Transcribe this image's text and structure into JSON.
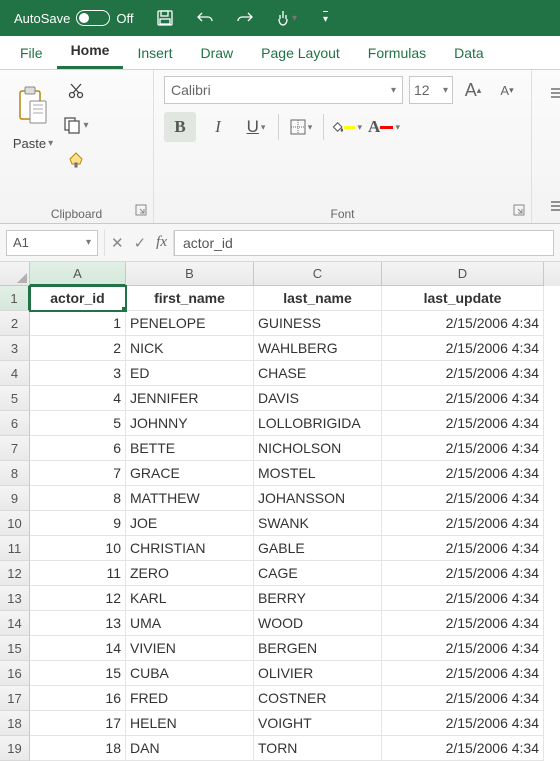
{
  "titlebar": {
    "autosave_label": "AutoSave",
    "autosave_state": "Off"
  },
  "tabs": {
    "file": "File",
    "home": "Home",
    "insert": "Insert",
    "draw": "Draw",
    "page_layout": "Page Layout",
    "formulas": "Formulas",
    "data": "Data"
  },
  "ribbon": {
    "clipboard": {
      "paste": "Paste",
      "label": "Clipboard"
    },
    "font": {
      "name": "Calibri",
      "size": "12",
      "grow": "A",
      "shrink": "A",
      "bold": "B",
      "italic": "I",
      "underline": "U",
      "label": "Font",
      "fill_color": "#ffff00",
      "font_color": "#ff0000"
    }
  },
  "formula_bar": {
    "namebox": "A1",
    "fx": "fx",
    "value": "actor_id"
  },
  "columns": [
    "A",
    "B",
    "C",
    "D"
  ],
  "headers": [
    "actor_id",
    "first_name",
    "last_name",
    "last_update"
  ],
  "rows": [
    {
      "n": "1",
      "id": "1",
      "fn": "PENELOPE",
      "ln": "GUINESS",
      "ts": "2/15/2006 4:34"
    },
    {
      "n": "2",
      "id": "2",
      "fn": "NICK",
      "ln": "WAHLBERG",
      "ts": "2/15/2006 4:34"
    },
    {
      "n": "3",
      "id": "3",
      "fn": "ED",
      "ln": "CHASE",
      "ts": "2/15/2006 4:34"
    },
    {
      "n": "4",
      "id": "4",
      "fn": "JENNIFER",
      "ln": "DAVIS",
      "ts": "2/15/2006 4:34"
    },
    {
      "n": "5",
      "id": "5",
      "fn": "JOHNNY",
      "ln": "LOLLOBRIGIDA",
      "ts": "2/15/2006 4:34"
    },
    {
      "n": "6",
      "id": "6",
      "fn": "BETTE",
      "ln": "NICHOLSON",
      "ts": "2/15/2006 4:34"
    },
    {
      "n": "7",
      "id": "7",
      "fn": "GRACE",
      "ln": "MOSTEL",
      "ts": "2/15/2006 4:34"
    },
    {
      "n": "8",
      "id": "8",
      "fn": "MATTHEW",
      "ln": "JOHANSSON",
      "ts": "2/15/2006 4:34"
    },
    {
      "n": "9",
      "id": "9",
      "fn": "JOE",
      "ln": "SWANK",
      "ts": "2/15/2006 4:34"
    },
    {
      "n": "10",
      "id": "10",
      "fn": "CHRISTIAN",
      "ln": "GABLE",
      "ts": "2/15/2006 4:34"
    },
    {
      "n": "11",
      "id": "11",
      "fn": "ZERO",
      "ln": "CAGE",
      "ts": "2/15/2006 4:34"
    },
    {
      "n": "12",
      "id": "12",
      "fn": "KARL",
      "ln": "BERRY",
      "ts": "2/15/2006 4:34"
    },
    {
      "n": "13",
      "id": "13",
      "fn": "UMA",
      "ln": "WOOD",
      "ts": "2/15/2006 4:34"
    },
    {
      "n": "14",
      "id": "14",
      "fn": "VIVIEN",
      "ln": "BERGEN",
      "ts": "2/15/2006 4:34"
    },
    {
      "n": "15",
      "id": "15",
      "fn": "CUBA",
      "ln": "OLIVIER",
      "ts": "2/15/2006 4:34"
    },
    {
      "n": "16",
      "id": "16",
      "fn": "FRED",
      "ln": "COSTNER",
      "ts": "2/15/2006 4:34"
    },
    {
      "n": "17",
      "id": "17",
      "fn": "HELEN",
      "ln": "VOIGHT",
      "ts": "2/15/2006 4:34"
    },
    {
      "n": "18",
      "id": "18",
      "fn": "DAN",
      "ln": "TORN",
      "ts": "2/15/2006 4:34"
    }
  ]
}
